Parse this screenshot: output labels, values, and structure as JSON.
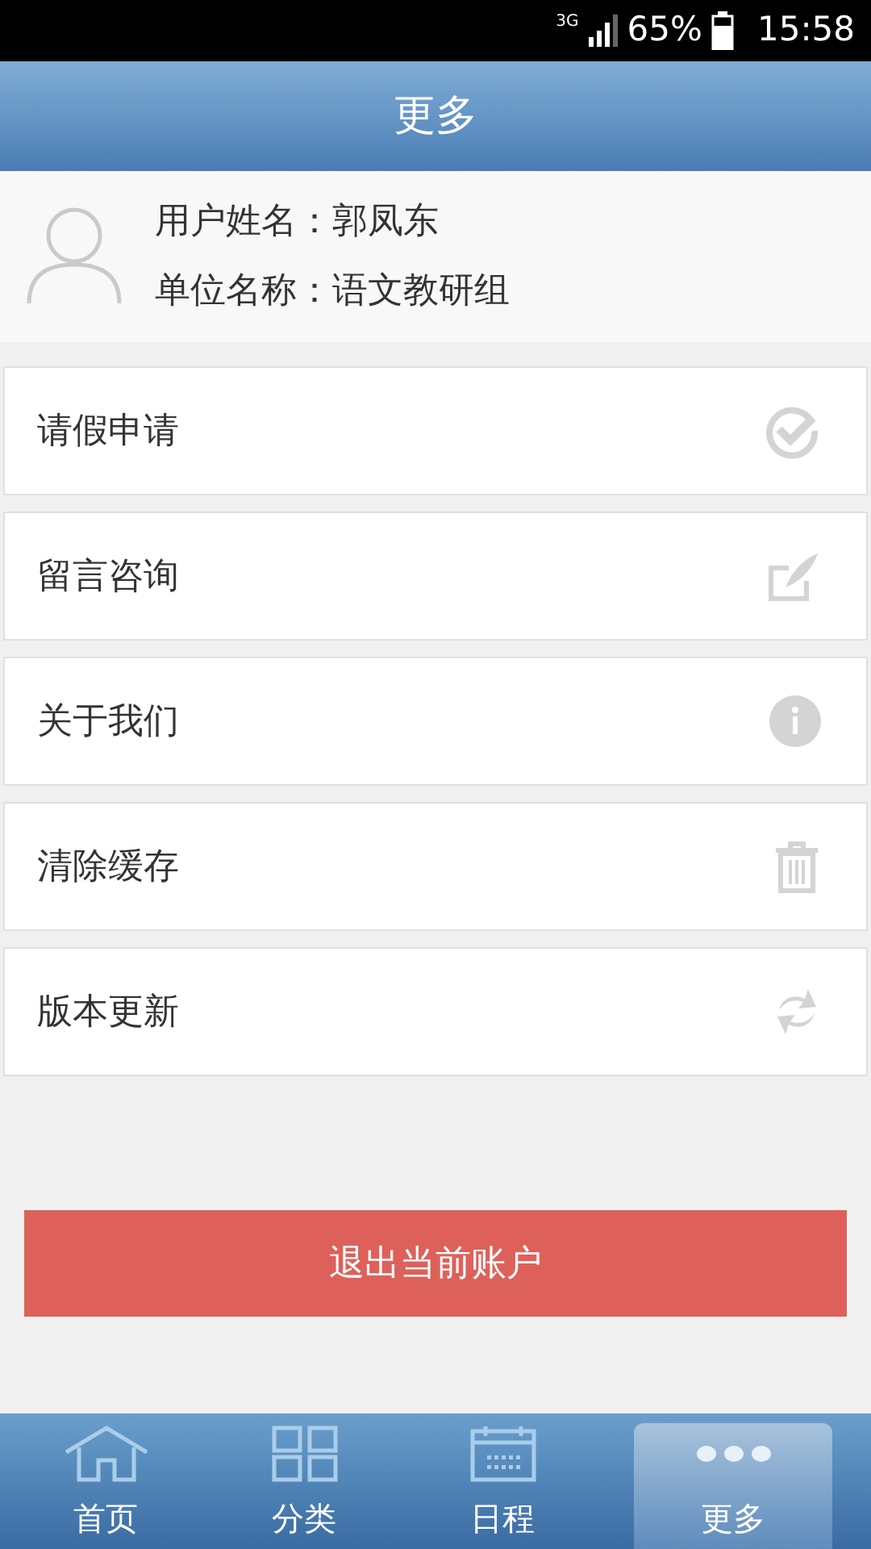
{
  "status_bar": {
    "network": "3G",
    "battery": "65%",
    "time": "15:58"
  },
  "header": {
    "title": "更多"
  },
  "profile": {
    "name_label": "用户姓名：",
    "name": "郭凤东",
    "unit_label": "单位名称：",
    "unit": "语文教研组"
  },
  "menu": [
    {
      "label": "请假申请",
      "kind": "check"
    },
    {
      "label": "留言咨询",
      "kind": "edit"
    },
    {
      "label": "关于我们",
      "kind": "info"
    },
    {
      "label": "清除缓存",
      "kind": "trash"
    },
    {
      "label": "版本更新",
      "kind": "refresh"
    }
  ],
  "logout_button": "退出当前账户",
  "tabs": [
    {
      "label": "首页",
      "kind": "home",
      "selected": false
    },
    {
      "label": "分类",
      "kind": "grid",
      "selected": false
    },
    {
      "label": "日程",
      "kind": "calendar",
      "selected": false
    },
    {
      "label": "更多",
      "kind": "more",
      "selected": true
    }
  ]
}
